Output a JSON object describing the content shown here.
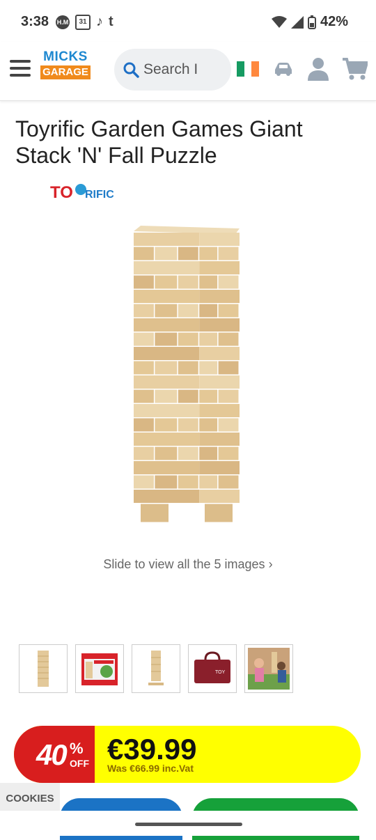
{
  "status_bar": {
    "time": "3:38",
    "notif_1": "H.M",
    "calendar_day": "31",
    "battery": "42%"
  },
  "header": {
    "logo_top": "MICKS",
    "logo_bottom": "GARAGE",
    "search_placeholder": "Search I",
    "colors": {
      "logo_blue": "#1e88d0",
      "logo_orange": "#f08a1c",
      "icon_blue": "#2a7fd0",
      "icon_grey": "#9aa7b5"
    }
  },
  "product": {
    "title": "Toyrific Garden Games Giant Stack 'N' Fall Puzzle",
    "brand_logo_text": "TOYRIFIC",
    "slide_hint": "Slide to view all the 5 images",
    "slide_arrow": "›",
    "thumbnails": [
      "tower",
      "box",
      "tower-tall",
      "bag",
      "kids-playing"
    ]
  },
  "price": {
    "discount_number": "40",
    "discount_pct": "%",
    "discount_off": "OFF",
    "current": "€39.99",
    "was": "Was €66.99 inc.Vat",
    "colors": {
      "bar": "#ffff00",
      "discount_bg": "#d81e1e"
    }
  },
  "cookies_label": "COOKIES"
}
